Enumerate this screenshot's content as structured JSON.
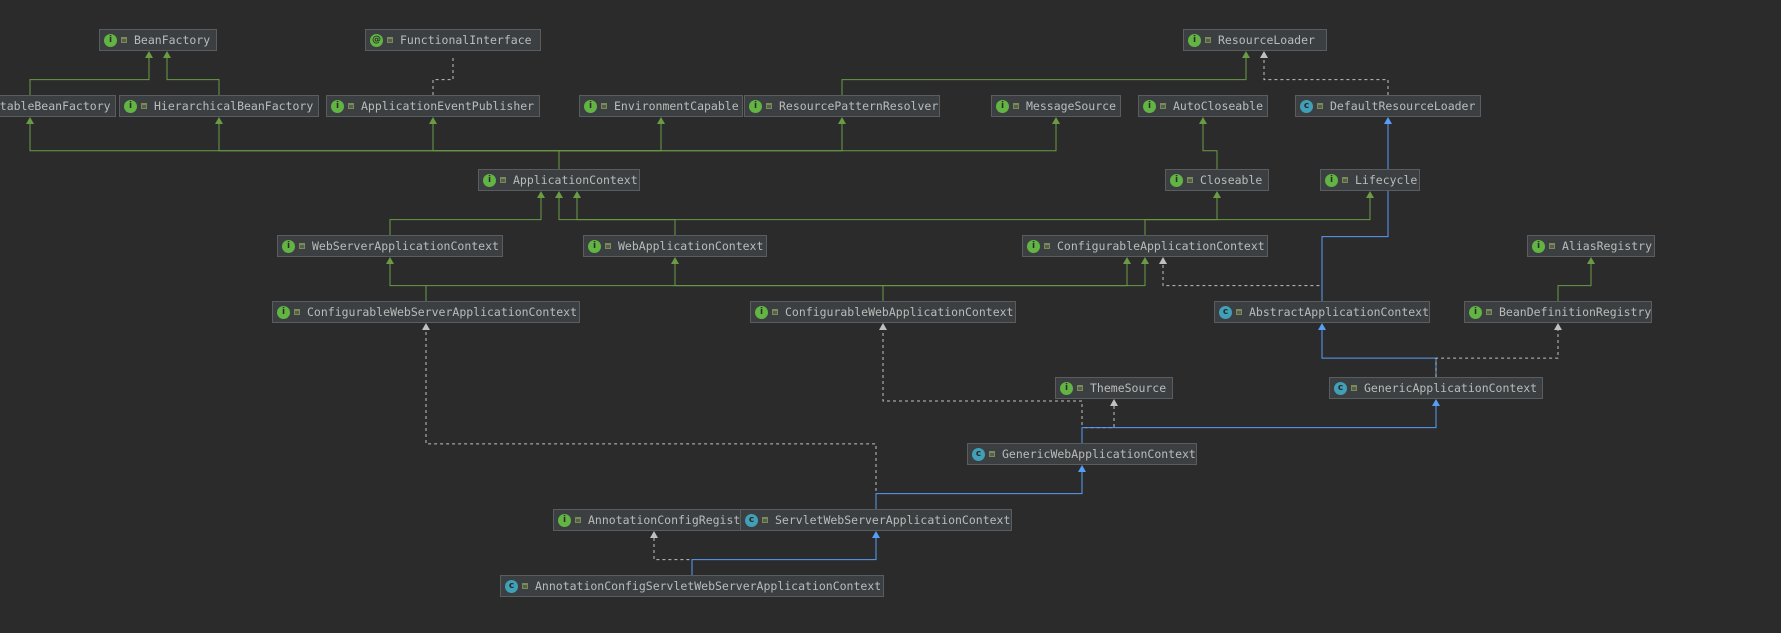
{
  "colors": {
    "background": "#2b2b2b",
    "interface_icon": "#62b543",
    "class_icon": "#40a0b8",
    "interface_extends_edge": "#6a9b45",
    "class_extends_edge": "#589df6",
    "implements_edge": "#c0c0c0"
  },
  "nodes": [
    {
      "id": "BeanFactory",
      "label": "BeanFactory",
      "kind": "interface",
      "icon": "interface-icon"
    },
    {
      "id": "FunctionalInterface",
      "label": "FunctionalInterface",
      "kind": "annotation",
      "icon": "annotation-icon"
    },
    {
      "id": "ResourceLoader",
      "label": "ResourceLoader",
      "kind": "interface",
      "icon": "interface-icon"
    },
    {
      "id": "ListableBeanFactory",
      "label": "ListableBeanFactory",
      "kind": "interface",
      "icon": "interface-icon"
    },
    {
      "id": "HierarchicalBeanFactory",
      "label": "HierarchicalBeanFactory",
      "kind": "interface",
      "icon": "interface-icon"
    },
    {
      "id": "ApplicationEventPublisher",
      "label": "ApplicationEventPublisher",
      "kind": "interface",
      "icon": "interface-icon"
    },
    {
      "id": "EnvironmentCapable",
      "label": "EnvironmentCapable",
      "kind": "interface",
      "icon": "interface-icon"
    },
    {
      "id": "ResourcePatternResolver",
      "label": "ResourcePatternResolver",
      "kind": "interface",
      "icon": "interface-icon"
    },
    {
      "id": "MessageSource",
      "label": "MessageSource",
      "kind": "interface",
      "icon": "interface-icon"
    },
    {
      "id": "AutoCloseable",
      "label": "AutoCloseable",
      "kind": "interface",
      "icon": "interface-icon"
    },
    {
      "id": "DefaultResourceLoader",
      "label": "DefaultResourceLoader",
      "kind": "class",
      "icon": "class-icon"
    },
    {
      "id": "ApplicationContext",
      "label": "ApplicationContext",
      "kind": "interface",
      "icon": "interface-icon"
    },
    {
      "id": "Closeable",
      "label": "Closeable",
      "kind": "interface",
      "icon": "interface-icon"
    },
    {
      "id": "Lifecycle",
      "label": "Lifecycle",
      "kind": "interface",
      "icon": "interface-icon"
    },
    {
      "id": "WebServerApplicationContext",
      "label": "WebServerApplicationContext",
      "kind": "interface",
      "icon": "interface-icon"
    },
    {
      "id": "WebApplicationContext",
      "label": "WebApplicationContext",
      "kind": "interface",
      "icon": "interface-icon"
    },
    {
      "id": "ConfigurableApplicationContext",
      "label": "ConfigurableApplicationContext",
      "kind": "interface",
      "icon": "interface-icon"
    },
    {
      "id": "AliasRegistry",
      "label": "AliasRegistry",
      "kind": "interface",
      "icon": "interface-icon"
    },
    {
      "id": "ConfigurableWebServerApplicationContext",
      "label": "ConfigurableWebServerApplicationContext",
      "kind": "interface",
      "icon": "interface-icon"
    },
    {
      "id": "ConfigurableWebApplicationContext",
      "label": "ConfigurableWebApplicationContext",
      "kind": "interface",
      "icon": "interface-icon"
    },
    {
      "id": "AbstractApplicationContext",
      "label": "AbstractApplicationContext",
      "kind": "class",
      "icon": "abstract-class-icon"
    },
    {
      "id": "BeanDefinitionRegistry",
      "label": "BeanDefinitionRegistry",
      "kind": "interface",
      "icon": "interface-icon"
    },
    {
      "id": "ThemeSource",
      "label": "ThemeSource",
      "kind": "interface",
      "icon": "interface-icon"
    },
    {
      "id": "GenericApplicationContext",
      "label": "GenericApplicationContext",
      "kind": "class",
      "icon": "class-icon"
    },
    {
      "id": "GenericWebApplicationContext",
      "label": "GenericWebApplicationContext",
      "kind": "class",
      "icon": "class-icon"
    },
    {
      "id": "AnnotationConfigRegistry",
      "label": "AnnotationConfigRegistry",
      "kind": "interface",
      "icon": "interface-icon"
    },
    {
      "id": "ServletWebServerApplicationContext",
      "label": "ServletWebServerApplicationContext",
      "kind": "class",
      "icon": "class-icon"
    },
    {
      "id": "AnnotationConfigServletWebServerApplicationContext",
      "label": "AnnotationConfigServletWebServerApplicationContext",
      "kind": "class",
      "icon": "class-icon"
    }
  ],
  "edges": [
    {
      "from": "ListableBeanFactory",
      "to": "BeanFactory",
      "type": "extends-interface"
    },
    {
      "from": "HierarchicalBeanFactory",
      "to": "BeanFactory",
      "type": "extends-interface"
    },
    {
      "from": "ApplicationEventPublisher",
      "to": "FunctionalInterface",
      "type": "annotated"
    },
    {
      "from": "ResourcePatternResolver",
      "to": "ResourceLoader",
      "type": "extends-interface"
    },
    {
      "from": "DefaultResourceLoader",
      "to": "ResourceLoader",
      "type": "implements"
    },
    {
      "from": "ApplicationContext",
      "to": "ListableBeanFactory",
      "type": "extends-interface"
    },
    {
      "from": "ApplicationContext",
      "to": "HierarchicalBeanFactory",
      "type": "extends-interface"
    },
    {
      "from": "ApplicationContext",
      "to": "ApplicationEventPublisher",
      "type": "extends-interface"
    },
    {
      "from": "ApplicationContext",
      "to": "EnvironmentCapable",
      "type": "extends-interface"
    },
    {
      "from": "ApplicationContext",
      "to": "ResourcePatternResolver",
      "type": "extends-interface"
    },
    {
      "from": "ApplicationContext",
      "to": "MessageSource",
      "type": "extends-interface"
    },
    {
      "from": "Closeable",
      "to": "AutoCloseable",
      "type": "extends-interface"
    },
    {
      "from": "WebServerApplicationContext",
      "to": "ApplicationContext",
      "type": "extends-interface"
    },
    {
      "from": "WebApplicationContext",
      "to": "ApplicationContext",
      "type": "extends-interface"
    },
    {
      "from": "ConfigurableApplicationContext",
      "to": "ApplicationContext",
      "type": "extends-interface"
    },
    {
      "from": "ConfigurableApplicationContext",
      "to": "Closeable",
      "type": "extends-interface"
    },
    {
      "from": "ConfigurableApplicationContext",
      "to": "Lifecycle",
      "type": "extends-interface"
    },
    {
      "from": "ConfigurableWebServerApplicationContext",
      "to": "WebServerApplicationContext",
      "type": "extends-interface"
    },
    {
      "from": "ConfigurableWebServerApplicationContext",
      "to": "ConfigurableApplicationContext",
      "type": "extends-interface"
    },
    {
      "from": "ConfigurableWebApplicationContext",
      "to": "WebApplicationContext",
      "type": "extends-interface"
    },
    {
      "from": "ConfigurableWebApplicationContext",
      "to": "ConfigurableApplicationContext",
      "type": "extends-interface"
    },
    {
      "from": "AbstractApplicationContext",
      "to": "ConfigurableApplicationContext",
      "type": "implements"
    },
    {
      "from": "AbstractApplicationContext",
      "to": "DefaultResourceLoader",
      "type": "extends-class"
    },
    {
      "from": "BeanDefinitionRegistry",
      "to": "AliasRegistry",
      "type": "extends-interface"
    },
    {
      "from": "GenericApplicationContext",
      "to": "AbstractApplicationContext",
      "type": "extends-class"
    },
    {
      "from": "GenericApplicationContext",
      "to": "BeanDefinitionRegistry",
      "type": "implements"
    },
    {
      "from": "GenericWebApplicationContext",
      "to": "ConfigurableWebApplicationContext",
      "type": "implements"
    },
    {
      "from": "GenericWebApplicationContext",
      "to": "ThemeSource",
      "type": "implements"
    },
    {
      "from": "GenericWebApplicationContext",
      "to": "GenericApplicationContext",
      "type": "extends-class"
    },
    {
      "from": "ServletWebServerApplicationContext",
      "to": "ConfigurableWebServerApplicationContext",
      "type": "implements"
    },
    {
      "from": "ServletWebServerApplicationContext",
      "to": "GenericWebApplicationContext",
      "type": "extends-class"
    },
    {
      "from": "AnnotationConfigServletWebServerApplicationContext",
      "to": "AnnotationConfigRegistry",
      "type": "implements"
    },
    {
      "from": "AnnotationConfigServletWebServerApplicationContext",
      "to": "ServletWebServerApplicationContext",
      "type": "extends-class"
    }
  ]
}
